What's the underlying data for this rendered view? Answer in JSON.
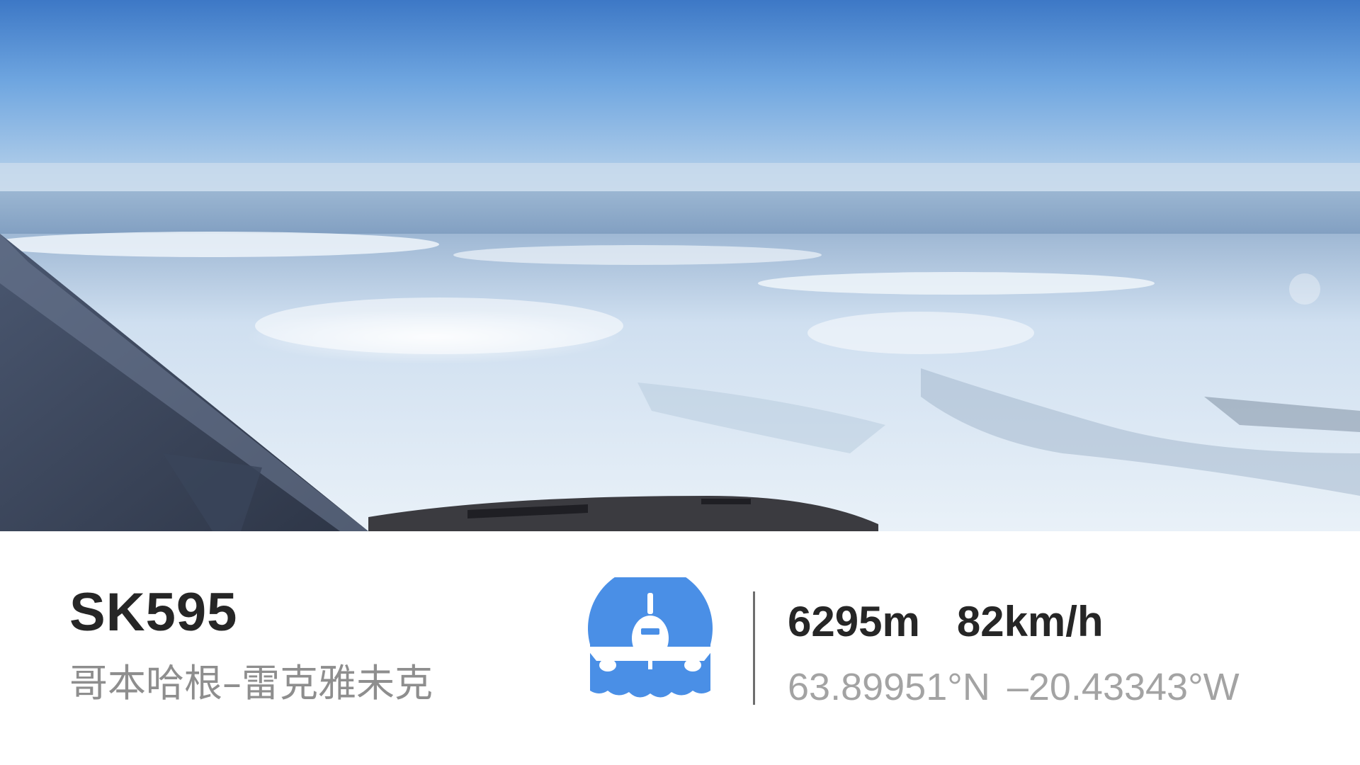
{
  "flight": {
    "code": "SK595",
    "route": "哥本哈根–雷克雅未克"
  },
  "telemetry": {
    "altitude": "6295m",
    "speed": "82km/h",
    "latitude": "63.89951°N",
    "longitude": "–20.43343°W"
  },
  "logo_icon": "airplane-front-icon",
  "colors": {
    "logo_blue": "#4a8fe6",
    "title_text": "#262626",
    "secondary_text": "#8e8e8e",
    "sky_top": "#3f7ac8",
    "snow": "#e9f1f8"
  }
}
